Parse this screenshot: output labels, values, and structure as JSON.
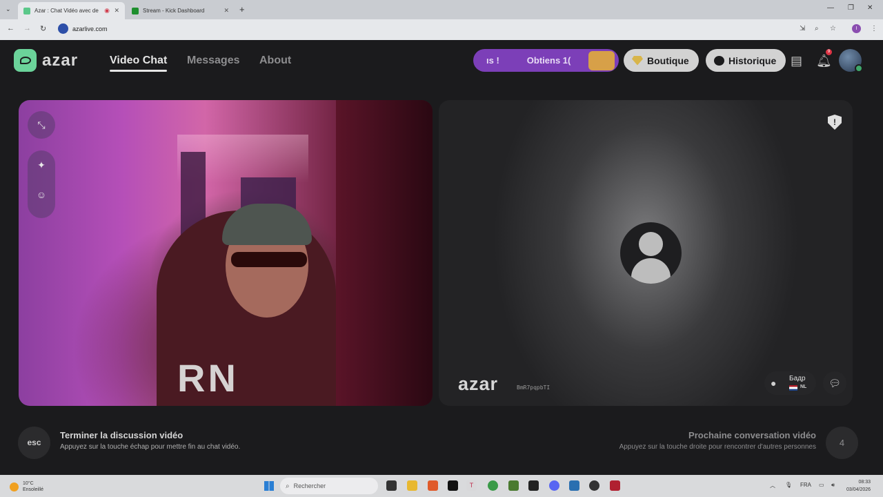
{
  "browser": {
    "tabs": [
      {
        "title": "Azar : Chat Vidéo avec de",
        "active": true
      },
      {
        "title": "Stream - Kick Dashboard",
        "active": false
      }
    ],
    "url": "azarlive.com",
    "profile_initial": "I"
  },
  "header": {
    "logo_text": "azar",
    "nav": [
      "Video Chat",
      "Messages",
      "About"
    ],
    "promo_left": "ıs !",
    "promo_text": "Obtiens 1(",
    "shop_label": "Boutique",
    "history_label": "Historique",
    "notification_count": "9"
  },
  "video": {
    "left_print": "RN",
    "watermark": "azar",
    "watermark_id": "BmR7pqpbTI",
    "peer_name": "Бадр",
    "peer_country": "NL"
  },
  "controls": {
    "esc_label": "esc",
    "end_title": "Terminer la discussion vidéo",
    "end_sub": "Appuyez sur la touche échap pour mettre fin au chat vidéo.",
    "next_title": "Prochaine conversation vidéo",
    "next_sub": "Appuyez sur la touche droite pour rencontrer d'autres personnes",
    "next_key": "4"
  },
  "taskbar": {
    "temperature": "10°C",
    "weather": "Ensoleillé",
    "search_placeholder": "Rechercher",
    "lang": "FRA",
    "time": "08:33",
    "date": "03/04/2026"
  },
  "colors": {
    "accent_purple": "#7c3fb8",
    "logo_green": "#6bd39a",
    "background": "#1b1b1d"
  }
}
